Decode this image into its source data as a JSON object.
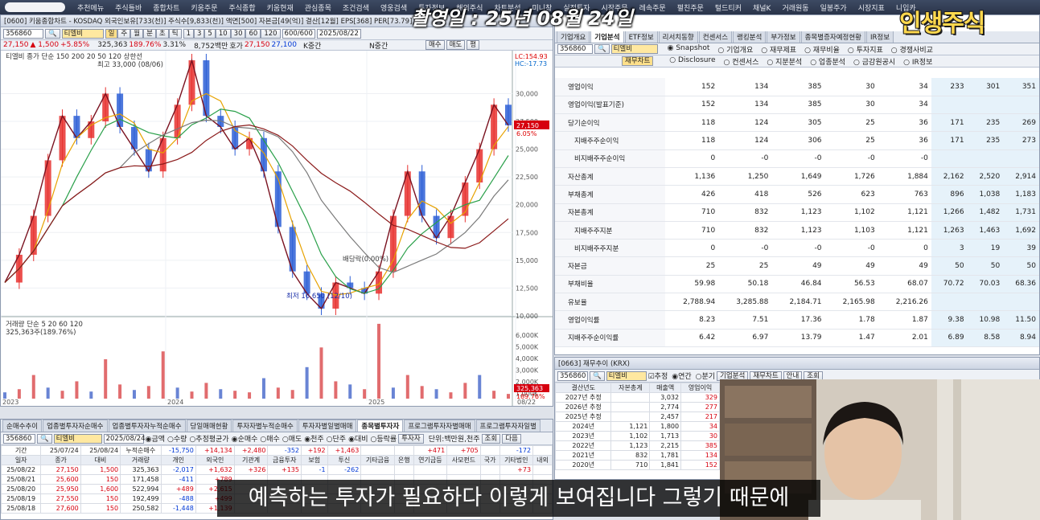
{
  "menubar": {
    "items": [
      "추천메뉴",
      "주식틀바",
      "종합차트",
      "키움주문",
      "주식종합",
      "키움현재",
      "관심종목",
      "조건검색",
      "영웅검색",
      "투자정보",
      "해외주식",
      "차트분석",
      "미니창",
      "실전투자",
      "시장주문",
      "레속주문",
      "펼친주문",
      "털드티커",
      "채널K",
      "거래원동",
      "일봉주가",
      "시장지표",
      "니입카"
    ]
  },
  "overlay": {
    "date": "촬영일 : 25년 08월 24일",
    "logo": "인생주식"
  },
  "chart": {
    "title": "[0600] 키움종합차트 - KOSDAQ 외국인보유[733(천)] 주식수[9,833(천)] 액면[500] 자본금[49(억)] 결산[12월] EPS[368] PER[73.79]",
    "code": "356860",
    "name": "티엘비",
    "periods": [
      "일",
      "주",
      "월",
      "분",
      "초",
      "틱"
    ],
    "mins": [
      "1",
      "3",
      "5",
      "10",
      "30",
      "60",
      "120"
    ],
    "count": "600/600",
    "date": "2025/08/22",
    "quote": {
      "price": "27,150",
      "change": "▲ 1,500",
      "pct": "+5.85%",
      "volume": "325,363",
      "vpct": "189.76%",
      "turn": "3.31%",
      "amount": "8,752백만",
      "hoga": "호가",
      "ask": "27,150",
      "bid": "27,100",
      "k1": "K중간",
      "k2": "N중간",
      "sell": "매수",
      "buy": "매도",
      "flag": "평"
    },
    "legend": "티엘비  종가 단순 150 200 20 50 120 상한선",
    "max_label": "최고 33,000 (08/06)",
    "min_label": "최저 10,650 (12/10)",
    "midnote": "배당락(0.00%)",
    "lc": "LC:154.93",
    "hc": "HC:-17.73",
    "last_price": "27,150",
    "last_pct": "6.05%",
    "price_ticks": [
      "30,000",
      "27,500",
      "25,000",
      "22,500",
      "20,000",
      "17,500",
      "15,000",
      "12,500",
      "10,000"
    ],
    "vol_legend": "거래량  단순 5 20 60 120",
    "vol_value": "325,363주(189.76%)",
    "vol_ticks": [
      "6,000K",
      "5,000K",
      "4,000K",
      "3,000K",
      "2,000K",
      "1,000K"
    ],
    "vol_last": "325,363",
    "vol_pct": "189.76%",
    "x_labels": [
      "2023",
      "2024",
      "2025",
      "08/22"
    ]
  },
  "chart_data": {
    "type": "line",
    "title": "티엘비",
    "ylim": [
      10000,
      33000
    ],
    "series": [
      {
        "name": "종가",
        "values": [
          13000,
          15500,
          19000,
          24000,
          28000,
          26000,
          27500,
          30000,
          27000,
          25000,
          23000,
          26000,
          29000,
          33000,
          28000,
          27000,
          25000,
          26000,
          23000,
          18000,
          14000,
          12000,
          10650,
          13000,
          12500,
          12000,
          14000,
          19000,
          23000,
          19000,
          17000,
          19000,
          22000,
          25000,
          29000,
          27150
        ]
      }
    ]
  },
  "fin": {
    "title_tabs": [
      "기업개요",
      "기업분석",
      "ETF정보",
      "리서치동향",
      "컨센서스",
      "랭킹분석",
      "부가정보",
      "종목별증자예정현황",
      "IR정보"
    ],
    "code": "356860",
    "name": "티엘비",
    "btn_chart": "재무차트",
    "radios1": [
      "Snapshot",
      "기업개요",
      "재무제표",
      "재무비율",
      "투자지표",
      "경쟁사비교"
    ],
    "radios2": [
      "Disclosure",
      "컨센서스",
      "지분분석",
      "업종분석",
      "금감원공시",
      "IR정보"
    ],
    "rows": [
      {
        "label": "영업이익",
        "v": [
          "152",
          "134",
          "385",
          "30",
          "34",
          "233",
          "301",
          "351"
        ]
      },
      {
        "label": "영업이익(발표기준)",
        "v": [
          "152",
          "134",
          "385",
          "30",
          "34",
          "",
          "",
          ""
        ]
      },
      {
        "label": "당기순이익",
        "v": [
          "118",
          "124",
          "305",
          "25",
          "36",
          "171",
          "235",
          "269"
        ]
      },
      {
        "label": "지배주주순이익",
        "sub": true,
        "v": [
          "118",
          "124",
          "306",
          "25",
          "36",
          "171",
          "235",
          "273"
        ]
      },
      {
        "label": "비지배주주순이익",
        "sub": true,
        "v": [
          "0",
          "-0",
          "-0",
          "-0",
          "-0",
          "",
          "",
          ""
        ]
      },
      {
        "label": "자산총계",
        "v": [
          "1,136",
          "1,250",
          "1,649",
          "1,726",
          "1,884",
          "2,162",
          "2,520",
          "2,914"
        ]
      },
      {
        "label": "부채총계",
        "v": [
          "426",
          "418",
          "526",
          "623",
          "763",
          "896",
          "1,038",
          "1,183"
        ]
      },
      {
        "label": "자본총계",
        "v": [
          "710",
          "832",
          "1,123",
          "1,102",
          "1,121",
          "1,266",
          "1,482",
          "1,731"
        ]
      },
      {
        "label": "지배주주지분",
        "sub": true,
        "v": [
          "710",
          "832",
          "1,123",
          "1,103",
          "1,121",
          "1,263",
          "1,463",
          "1,692"
        ]
      },
      {
        "label": "비지배주주지분",
        "sub": true,
        "v": [
          "0",
          "-0",
          "-0",
          "-0",
          "0",
          "3",
          "19",
          "39"
        ]
      },
      {
        "label": "자본금",
        "v": [
          "25",
          "25",
          "49",
          "49",
          "49",
          "50",
          "50",
          "50"
        ]
      },
      {
        "label": "부채비율",
        "v": [
          "59.98",
          "50.18",
          "46.84",
          "56.53",
          "68.07",
          "70.72",
          "70.03",
          "68.36"
        ]
      },
      {
        "label": "유보율",
        "v": [
          "2,788.94",
          "3,285.88",
          "2,184.71",
          "2,165.98",
          "2,216.26",
          "",
          "",
          ""
        ]
      },
      {
        "label": "영업이익률",
        "v": [
          "8.23",
          "7.51",
          "17.36",
          "1.78",
          "1.87",
          "9.38",
          "10.98",
          "11.50"
        ]
      },
      {
        "label": "지배주주순이익률",
        "v": [
          "6.42",
          "6.97",
          "13.79",
          "1.47",
          "2.01",
          "6.89",
          "8.58",
          "8.94"
        ]
      }
    ]
  },
  "trend": {
    "title": "[0663] 재무추이 (KRX)",
    "code": "356860",
    "name": "티엘비",
    "opts": [
      "추정",
      "연간",
      "분기"
    ],
    "btns": [
      "기업분석",
      "재무차트",
      "안내",
      "조회"
    ],
    "headers": [
      "결산년도",
      "자본총계",
      "매출액",
      "영업이익"
    ],
    "rows": [
      [
        "2027년 추정",
        "",
        "3,032",
        "329"
      ],
      [
        "2026년 추정",
        "",
        "2,774",
        "277"
      ],
      [
        "2025년 추정",
        "",
        "2,457",
        "217"
      ],
      [
        "2024년",
        "1,121",
        "1,800",
        "34"
      ],
      [
        "2023년",
        "1,102",
        "1,713",
        "30"
      ],
      [
        "2022년",
        "1,123",
        "2,215",
        "385"
      ],
      [
        "2021년",
        "832",
        "1,781",
        "134"
      ],
      [
        "2020년",
        "710",
        "1,841",
        "152"
      ]
    ]
  },
  "investor": {
    "tabs": [
      "순매수추이",
      "업종별투자자순매수",
      "업종별투자자누적순매수",
      "당일매매현황",
      "투자자별누적순매수",
      "투자자별일별매매",
      "종목별투자자",
      "프로그램투자자별매매",
      "프로그램투자자일별"
    ],
    "code": "356860",
    "name": "티엘비",
    "date": "2025/08/24",
    "opts1": [
      "금액",
      "수량",
      "추정평균가"
    ],
    "opts2": [
      "순매수",
      "매수",
      "매도"
    ],
    "opts3": [
      "천주",
      "단주"
    ],
    "opts4": [
      "대비",
      "등락률"
    ],
    "btn_inv": "투자자",
    "unit": "단위:백만원,천주",
    "btn_q": "조회",
    "btn_n": "다음",
    "period_label": "기간",
    "period_from": "25/07/24",
    "period_to": "25/08/24",
    "cum_label": "누적순매수",
    "cum": [
      "-15,750",
      "+14,134",
      "+2,480",
      "-352",
      "+192",
      "+1,463",
      "",
      "",
      "+471",
      "+705",
      "",
      "-172",
      ""
    ],
    "headers": [
      "일자",
      "종가",
      "대비",
      "거래량",
      "개인",
      "외국인",
      "기관계",
      "금융투자",
      "보험",
      "투신",
      "기타금융",
      "은행",
      "연기금등",
      "사모펀드",
      "국가",
      "기타법인",
      "내외"
    ],
    "rows": [
      [
        "25/08/22",
        "27,150",
        "1,500",
        "325,363",
        "-2,017",
        "+1,632",
        "+326",
        "+135",
        "-1",
        "-262",
        "",
        "",
        "",
        "",
        "",
        "+73",
        ""
      ],
      [
        "25/08/21",
        "25,600",
        "150",
        "171,458",
        "-411",
        "+789",
        "",
        "",
        "",
        "",
        "",
        "",
        "",
        "",
        "",
        "",
        ""
      ],
      [
        "25/08/20",
        "25,950",
        "1,600",
        "522,994",
        "+489",
        "+2,615",
        "",
        "",
        "",
        "",
        "",
        "",
        "",
        "",
        "",
        "",
        ""
      ],
      [
        "25/08/19",
        "27,550",
        "150",
        "192,499",
        "-488",
        "+499",
        "",
        "",
        "",
        "",
        "",
        "",
        "",
        "",
        "",
        "",
        ""
      ],
      [
        "25/08/18",
        "27,600",
        "150",
        "250,582",
        "-1,448",
        "+1,139",
        "",
        "",
        "",
        "",
        "",
        "",
        "",
        "",
        "",
        "",
        ""
      ]
    ]
  },
  "subtitle": "예측하는 투자가 필요하다 이렇게 보여집니다 그렇기 때문에"
}
